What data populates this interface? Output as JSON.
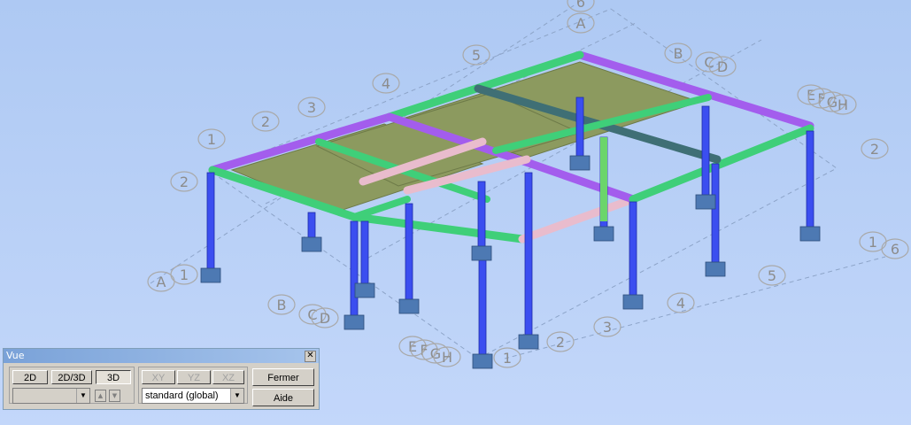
{
  "viewport": {
    "axis_labels": {
      "grid_letters": [
        "A",
        "B",
        "C",
        "D",
        "E",
        "F",
        "G",
        "H"
      ],
      "grid_numbers": [
        "1",
        "2",
        "3",
        "4",
        "5",
        "6"
      ],
      "level_labels": [
        "1",
        "2"
      ]
    }
  },
  "vue_dialog": {
    "title": "Vue",
    "close_glyph": "✕",
    "mode_buttons": [
      "2D",
      "2D/3D",
      "3D"
    ],
    "selected_mode": "3D",
    "plane_buttons": [
      "XY",
      "YZ",
      "XZ"
    ],
    "level_select_value": "",
    "coord_select_value": "standard (global)",
    "close_button": "Fermer",
    "help_button": "Aide"
  },
  "colors": {
    "column": "#3b4ef0",
    "beam_green": "#3fcf79",
    "beam_purple": "#a35ded",
    "beam_pink": "#e9bccd",
    "beam_dark": "#3f6f75",
    "slab": "#8c9a5f",
    "footing": "#4d79b3"
  }
}
